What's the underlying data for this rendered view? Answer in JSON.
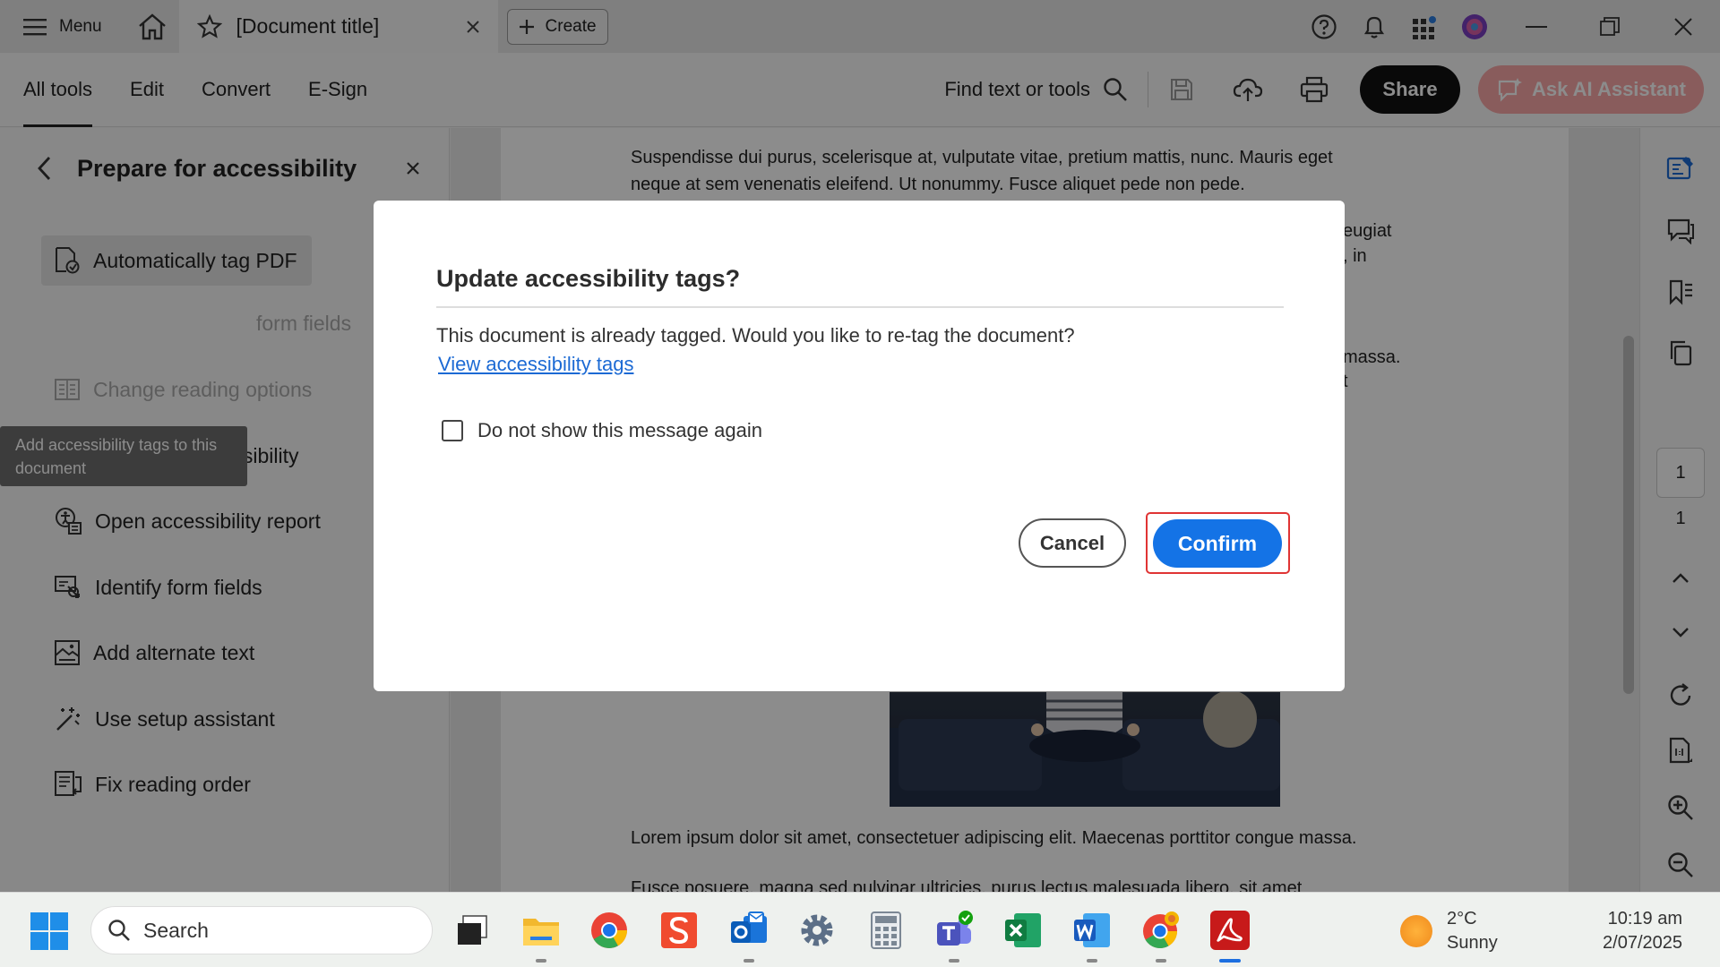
{
  "titlebar": {
    "menu_label": "Menu",
    "document_title": "[Document title]",
    "create_label": "Create"
  },
  "toolbar": {
    "tabs": [
      "All tools",
      "Edit",
      "Convert",
      "E-Sign"
    ],
    "find_label": "Find text or tools",
    "share_label": "Share",
    "ai_label": "Ask AI Assistant"
  },
  "left_panel": {
    "title": "Prepare for accessibility",
    "items": [
      {
        "label": "Automatically tag PDF",
        "icon": "auto-tag-icon"
      },
      {
        "label": "form fields",
        "icon": "form-fields-icon"
      },
      {
        "label": "Change reading options",
        "icon": "reading-options-icon"
      },
      {
        "label": "Check for accessibility",
        "icon": "accessibility-check-icon"
      },
      {
        "label": "Open accessibility report",
        "icon": "report-icon"
      },
      {
        "label": "Identify form fields",
        "icon": "identify-fields-icon"
      },
      {
        "label": "Add alternate text",
        "icon": "alt-text-icon"
      },
      {
        "label": "Use setup assistant",
        "icon": "wand-icon"
      },
      {
        "label": "Fix reading order",
        "icon": "reading-order-icon"
      }
    ],
    "tooltip_line1": "Add accessibility tags to this",
    "tooltip_line2": "document"
  },
  "document": {
    "para1_line1": "Suspendisse dui purus, scelerisque at, vulputate vitae, pretium mattis, nunc. Mauris eget",
    "para1_line2": "neque at sem venenatis eleifend. Ut nonummy. Fusce aliquet pede non pede.",
    "frag1": "eugiat",
    "frag2": ", in",
    "frag3": "massa.",
    "frag4": "t",
    "para2": "Lorem ipsum dolor sit amet, consectetuer adipiscing elit. Maecenas porttitor congue massa.",
    "para3": "Fusce posuere, magna sed pulvinar ultricies, purus lectus malesuada libero, sit amet"
  },
  "right_rail": {
    "current_page": "1",
    "total_pages": "1"
  },
  "dialog": {
    "title": "Update accessibility tags?",
    "body": "This document is already tagged. Would you like to re-tag the document?",
    "link": "View accessibility tags",
    "checkbox_label": "Do not show this message again",
    "cancel_label": "Cancel",
    "confirm_label": "Confirm"
  },
  "taskbar": {
    "search_label": "Search",
    "weather_temp": "2°C",
    "weather_desc": "Sunny",
    "time": "10:19 am",
    "date": "2/07/2025"
  }
}
